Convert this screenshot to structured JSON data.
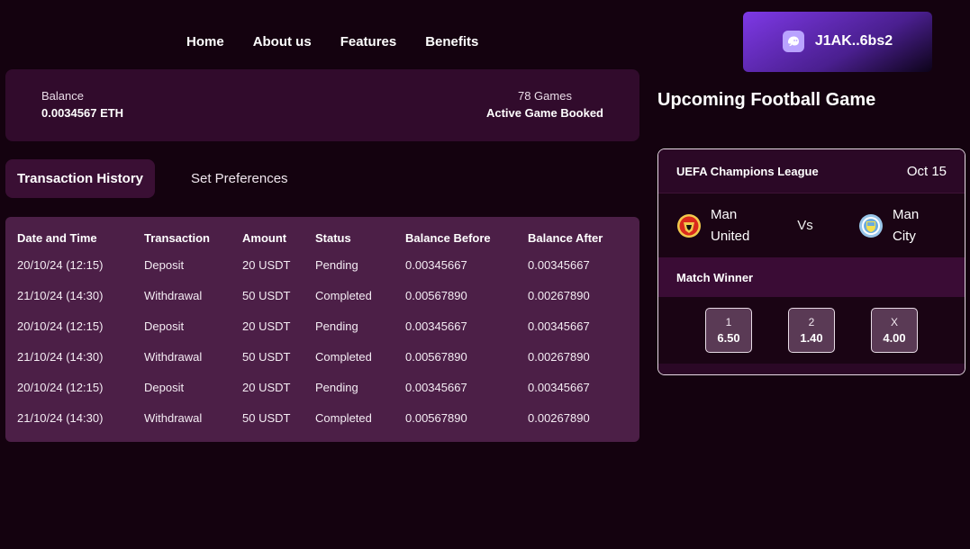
{
  "nav": {
    "items": [
      "Home",
      "About us",
      "Features",
      "Benefits"
    ]
  },
  "wallet": {
    "address": "J1AK..6bs2",
    "icon": "ghost-icon"
  },
  "balance": {
    "label": "Balance",
    "value": "0.0034567 ETH",
    "games_count": "78 Games",
    "games_label": "Active Game Booked"
  },
  "tabs": {
    "active": "Transaction History",
    "inactive": "Set Preferences"
  },
  "table": {
    "headers": [
      "Date and Time",
      "Transaction",
      "Amount",
      "Status",
      "Balance Before",
      "Balance After"
    ],
    "rows": [
      [
        "20/10/24 (12:15)",
        "Deposit",
        "20 USDT",
        "Pending",
        "0.00345667",
        "0.00345667"
      ],
      [
        "21/10/24 (14:30)",
        "Withdrawal",
        "50 USDT",
        "Completed",
        "0.00567890",
        "0.00267890"
      ],
      [
        "20/10/24 (12:15)",
        "Deposit",
        "20 USDT",
        "Pending",
        "0.00345667",
        "0.00345667"
      ],
      [
        "21/10/24 (14:30)",
        "Withdrawal",
        "50 USDT",
        "Completed",
        "0.00567890",
        "0.00267890"
      ],
      [
        "20/10/24 (12:15)",
        "Deposit",
        "20 USDT",
        "Pending",
        "0.00345667",
        "0.00345667"
      ],
      [
        "21/10/24 (14:30)",
        "Withdrawal",
        "50 USDT",
        "Completed",
        "0.00567890",
        "0.00267890"
      ]
    ]
  },
  "upcoming": {
    "title": "Upcoming Football Game",
    "league": "UEFA Champions League",
    "date": "Oct 15",
    "home_team": {
      "line1": "Man",
      "line2": "United",
      "crest": "man-united-crest-icon"
    },
    "vs": "Vs",
    "away_team": {
      "line1": "Man",
      "line2": "City",
      "crest": "man-city-crest-icon"
    },
    "market": "Match Winner",
    "odds": [
      {
        "label": "1",
        "value": "6.50"
      },
      {
        "label": "2",
        "value": "1.40"
      },
      {
        "label": "X",
        "value": "4.00"
      }
    ]
  },
  "colors": {
    "background": "#14020f",
    "card": "#310b2c",
    "table": "#4c1f47",
    "accent": "#7e39e6"
  }
}
